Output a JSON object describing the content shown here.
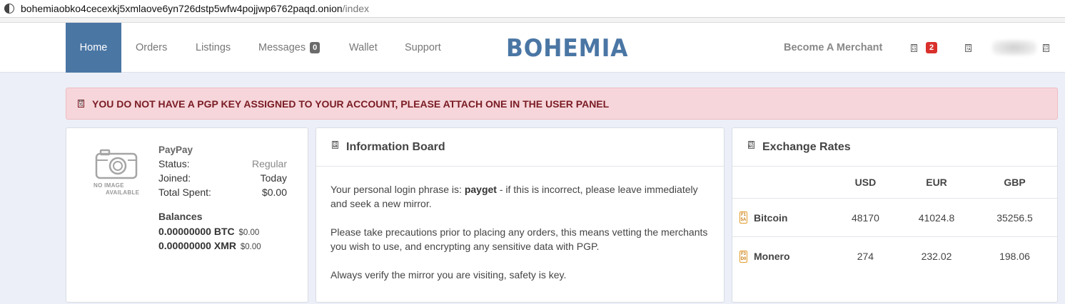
{
  "browser": {
    "url_host": "bohemiaobko4cecexkj5xmlaove6yn726dstp5wfw4pojjwp6762paqd.onion",
    "url_path": "/index"
  },
  "nav": {
    "items": [
      {
        "label": "Home"
      },
      {
        "label": "Orders"
      },
      {
        "label": "Listings"
      },
      {
        "label": "Messages",
        "badge": "0"
      },
      {
        "label": "Wallet"
      },
      {
        "label": "Support"
      }
    ],
    "logo": "BOHEMIA",
    "become_merchant": "Become A Merchant",
    "notifications_badge": "2"
  },
  "alert": {
    "text": "YOU DO NOT HAVE A PGP KEY ASSIGNED TO YOUR ACCOUNT, PLEASE ATTACH ONE IN THE USER PANEL"
  },
  "profile": {
    "no_image_line1": "NO IMAGE",
    "no_image_line2": "AVAILABLE",
    "username": "PayPay",
    "rows": [
      {
        "label": "Status:",
        "value": "Regular"
      },
      {
        "label": "Joined:",
        "value": "Today"
      },
      {
        "label": "Total Spent:",
        "value": "$0.00"
      }
    ],
    "balances_title": "Balances",
    "balances": [
      {
        "amount": "0.00000000 BTC",
        "usd": "$0.00"
      },
      {
        "amount": "0.00000000 XMR",
        "usd": "$0.00"
      }
    ]
  },
  "info_board": {
    "title": "Information Board",
    "p1_prefix": "Your personal login phrase is: ",
    "p1_phrase": "payget",
    "p1_suffix": " - if this is incorrect, please leave immediately and seek a new mirror.",
    "p2": "Please take precautions prior to placing any orders, this means vetting the merchants you wish to use, and encrypting any sensitive data with PGP.",
    "p3": "Always verify the mirror you are visiting, safety is key."
  },
  "rates": {
    "title": "Exchange Rates",
    "columns": [
      "USD",
      "EUR",
      "GBP"
    ],
    "rows": [
      {
        "name": "Bitcoin",
        "values": [
          "48170",
          "41024.8",
          "35256.5"
        ]
      },
      {
        "name": "Monero",
        "values": [
          "274",
          "232.02",
          "198.06"
        ]
      }
    ]
  },
  "colors": {
    "accent": "#4a76a4",
    "alert_bg": "#f6d6da",
    "alert_text": "#7a1c24",
    "badge_red": "#d9302c"
  }
}
